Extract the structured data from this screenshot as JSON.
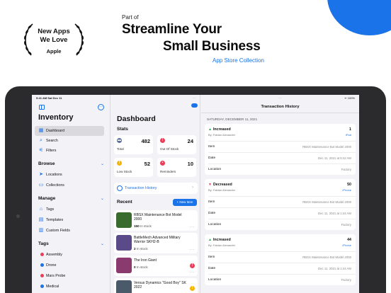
{
  "promo": {
    "award_line1": "New Apps",
    "award_line2": "We Love",
    "award_brand": "Apple",
    "part_of": "Part of",
    "headline1": "Streamline Your",
    "headline2": "Small Business",
    "collection": "App Store Collection",
    "accent_color": "#1a73e8"
  },
  "status_bar": {
    "time": "9:41 AM   Sat Dec 11",
    "right": "ᯤ 100%"
  },
  "sidebar": {
    "title": "Inventory",
    "items": [
      {
        "label": "Dashboard",
        "icon": "grid-icon",
        "glyph": "▦",
        "active": true
      },
      {
        "label": "Search",
        "icon": "search-icon",
        "glyph": "⌕"
      },
      {
        "label": "Filters",
        "icon": "filter-icon",
        "glyph": "⚟"
      }
    ],
    "browse": {
      "title": "Browse",
      "items": [
        {
          "label": "Locations",
          "icon": "location-icon",
          "glyph": "➤"
        },
        {
          "label": "Collections",
          "icon": "collections-icon",
          "glyph": "▭"
        }
      ]
    },
    "manage": {
      "title": "Manage",
      "items": [
        {
          "label": "Tags",
          "icon": "tag-icon",
          "glyph": "⌂"
        },
        {
          "label": "Templates",
          "icon": "templates-icon",
          "glyph": "▤"
        },
        {
          "label": "Custom Fields",
          "icon": "custom-fields-icon",
          "glyph": "▥"
        }
      ]
    },
    "tags": {
      "title": "Tags",
      "items": [
        {
          "label": "Assembly",
          "color": "#e8405a"
        },
        {
          "label": "Drone",
          "color": "#1a73e8"
        },
        {
          "label": "Mars Probe",
          "color": "#e8405a"
        },
        {
          "label": "Medical",
          "color": "#1a73e8"
        }
      ]
    }
  },
  "dashboard": {
    "title": "Dashboard",
    "stats_title": "Stats",
    "stats": [
      {
        "label": "Total",
        "value": "482",
        "color": "#5a6e9e",
        "glyph": "▬",
        "icon": "box-icon"
      },
      {
        "label": "Out Of Stock",
        "value": "24",
        "color": "#e8405a",
        "glyph": "!",
        "icon": "alert-icon"
      },
      {
        "label": "Low Stock",
        "value": "52",
        "color": "#f5b400",
        "glyph": "!",
        "icon": "warning-icon"
      },
      {
        "label": "Reminders",
        "value": "10",
        "color": "#e8405a",
        "glyph": "•",
        "icon": "reminder-icon"
      }
    ],
    "transaction_history_link": "Transaction History",
    "recent_title": "Recent",
    "new_item_label": "+ New Item",
    "recent_items": [
      {
        "name": "RBSX Maintenance Bot Model 2000",
        "qty": "150",
        "status": "In stock",
        "thumb": "#3a6b2e",
        "alert": null
      },
      {
        "name": "BattleMech Advanced Military Warrior SKH2-B",
        "qty": "2",
        "status": "In stock",
        "thumb": "#5a4a8a",
        "alert": null
      },
      {
        "name": "The Iron Giant",
        "qty": "0",
        "status": "In stock",
        "thumb": "#8a3a6e",
        "alert": "#e8405a"
      },
      {
        "name": "Versus Dynamics \"Good Boy\" SK 2022",
        "qty": "",
        "status": "",
        "thumb": "#4a5a6a",
        "alert": "#f5b400"
      }
    ]
  },
  "history": {
    "title": "Transaction History",
    "date": "SATURDAY, DECEMBER 11, 2021",
    "labels": {
      "item": "Item",
      "date": "Date",
      "location": "Location"
    },
    "transactions": [
      {
        "type": "Increased",
        "arrow": "▲",
        "arrow_color": "#2e9e4a",
        "qty": "1",
        "by": "By: Fabian Alexander",
        "device": "iPad",
        "item": "RBSX Maintenance Bot Model 2000",
        "date": "Dec 11, 2021 at 5:42 AM",
        "location": "Factory"
      },
      {
        "type": "Decreased",
        "arrow": "▼",
        "arrow_color": "#e8405a",
        "qty": "50",
        "by": "By: Fabian Alexander",
        "device": "iPhone",
        "item": "RBSX Maintenance Bot Model 2000",
        "date": "Dec 11, 2021 at 1:44 AM",
        "location": "Factory"
      },
      {
        "type": "Increased",
        "arrow": "▲",
        "arrow_color": "#2e9e4a",
        "qty": "44",
        "by": "By: Fabian Alexander",
        "device": "iPhone",
        "item": "RBSX Maintenance Bot Model 2000",
        "date": "Dec 11, 2021 at 1:44 AM",
        "location": "Factory"
      }
    ]
  }
}
